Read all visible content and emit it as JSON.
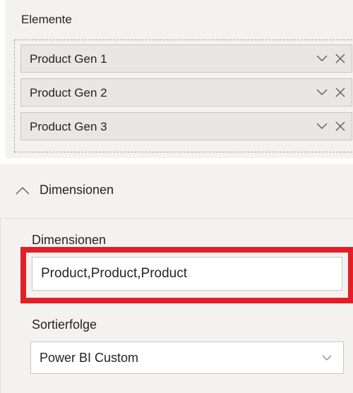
{
  "elements": {
    "label": "Elemente",
    "fields": [
      {
        "label": "Product Gen 1"
      },
      {
        "label": "Product Gen 2"
      },
      {
        "label": "Product Gen 3"
      }
    ]
  },
  "dimensions_section": {
    "header_label": "Dimensionen",
    "expanded": true,
    "dimensions_field": {
      "label": "Dimensionen",
      "value": "Product,Product,Product"
    },
    "sort_field": {
      "label": "Sortierfolge",
      "selected": "Power BI Custom"
    }
  },
  "colors": {
    "panel_bg": "#f3f2f1",
    "pill_bg": "#e8e7e6",
    "highlight": "#e31e27",
    "text": "#252423"
  },
  "icons": {
    "pill_expand": "chevron-down-icon",
    "pill_remove": "close-icon",
    "section_toggle": "chevron-up-icon",
    "select_expand": "chevron-down-icon"
  }
}
